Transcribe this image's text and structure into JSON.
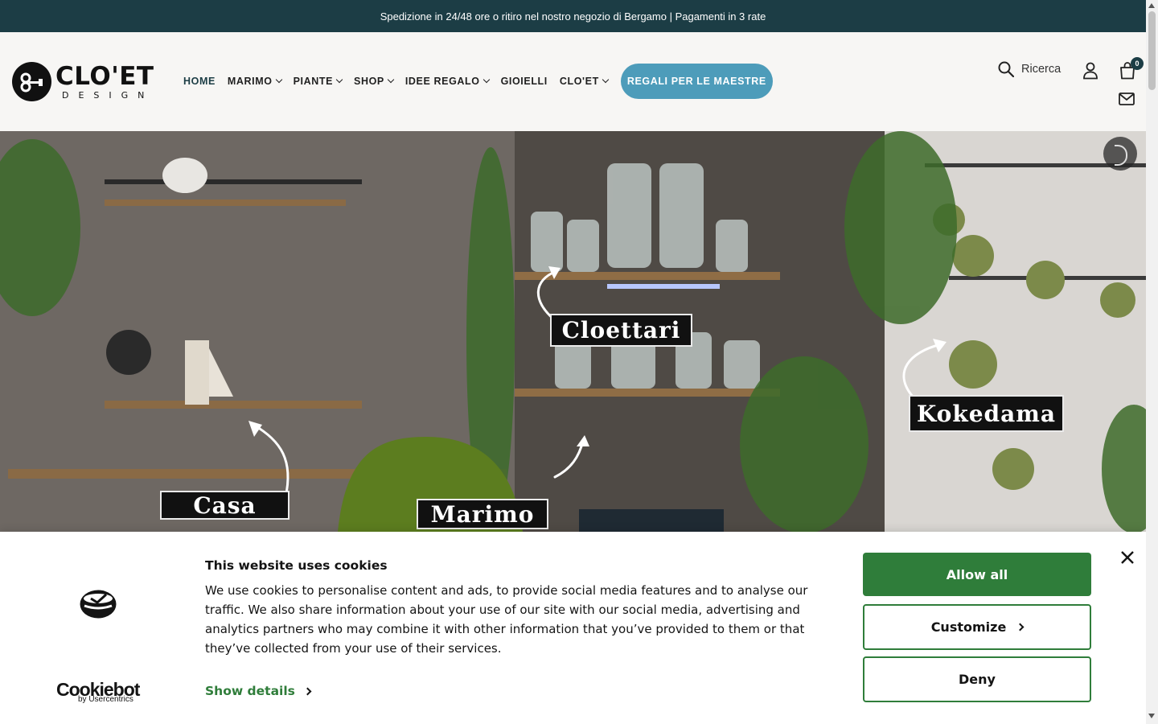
{
  "announcement": {
    "text": "Spedizione in 24/48 ore o ritiro nel nostro negozio di Bergamo | Pagamenti in 3 rate"
  },
  "logo": {
    "wordmark": "CLO'ET",
    "sub": "DESIGN"
  },
  "nav": {
    "items": [
      {
        "label": "HOME",
        "active": true,
        "dropdown": false
      },
      {
        "label": "MARIMO",
        "dropdown": true
      },
      {
        "label": "PIANTE",
        "dropdown": true
      },
      {
        "label": "SHOP",
        "dropdown": true
      },
      {
        "label": "IDEE REGALO",
        "dropdown": true
      },
      {
        "label": "GIOIELLI",
        "dropdown": false
      },
      {
        "label": "CLO'ET",
        "dropdown": true
      }
    ],
    "promo_label": "REGALI PER LE MAESTRE"
  },
  "header_actions": {
    "search_label": "Ricerca",
    "search_icon": "search-icon",
    "account_icon": "user-icon",
    "cart_icon": "bag-icon",
    "cart_count": "0",
    "contact_icon": "mail-icon"
  },
  "hero": {
    "tags": [
      "Cloettari",
      "Kokedama",
      "Casa",
      "Marimo"
    ],
    "media_control_icon": "pause-icon"
  },
  "cookie_banner": {
    "title": "This website uses cookies",
    "body": "We use cookies to personalise content and ads, to provide social media features and to analyse our traffic. We also share information about your use of our site with our social media, advertising and analytics partners who may combine it with other information that you’ve provided to them or that they’ve collected from your use of their services.",
    "show_details": "Show details",
    "allow_all": "Allow all",
    "customize": "Customize",
    "deny": "Deny",
    "brand": "Cookiebot",
    "brand_by": "by Usercentrics",
    "close_icon": "close-icon"
  },
  "colors": {
    "announcement_bg": "#1c3d45",
    "promo_button": "#4d9cba",
    "cookie_accent": "#2f7d3a"
  }
}
